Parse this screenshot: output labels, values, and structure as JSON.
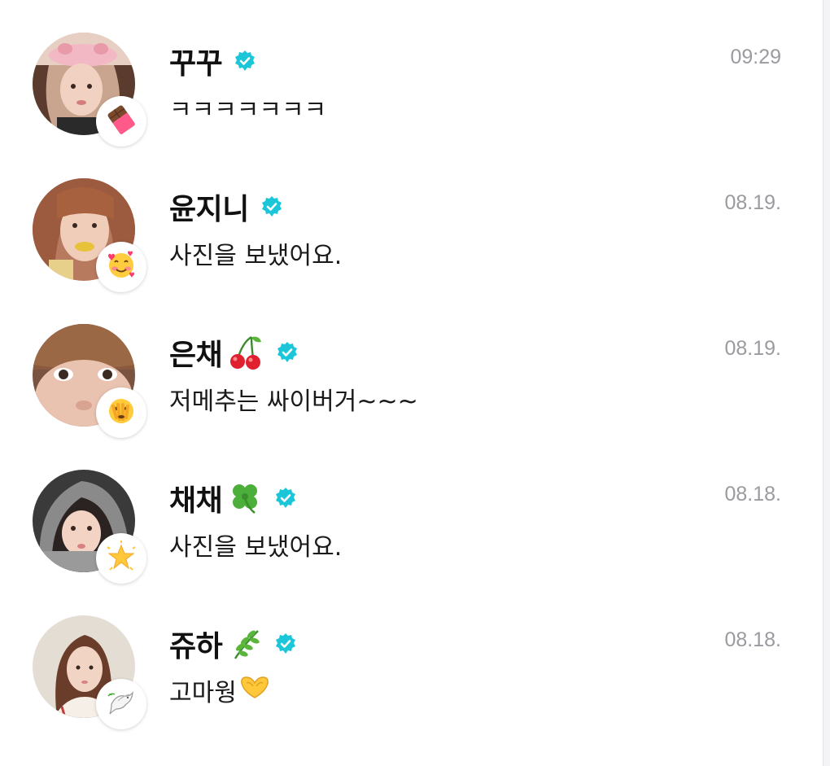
{
  "colors": {
    "verified_badge": "#1cc6d9",
    "time_text": "#9a9aa0",
    "name_text": "#111111"
  },
  "chats": [
    {
      "name": "꾸꾸",
      "name_emoji": "",
      "badge_icon": "chocolate-bar-icon",
      "last_message": "ㅋㅋㅋㅋㅋㅋㅋ",
      "message_emoji": "",
      "time": "09:29"
    },
    {
      "name": "윤지니",
      "name_emoji": "",
      "badge_icon": "smiling-face-with-hearts-icon",
      "last_message": "사진을 보냈어요.",
      "message_emoji": "",
      "time": "08.19."
    },
    {
      "name": "은채",
      "name_emoji": "cherries-icon",
      "badge_icon": "face-with-peeking-eye-icon",
      "last_message": "저메추는 싸이버거~~~",
      "message_emoji": "",
      "time": "08.19."
    },
    {
      "name": "채채",
      "name_emoji": "four-leaf-clover-icon",
      "badge_icon": "glowing-star-icon",
      "last_message": "사진을 보냈어요.",
      "message_emoji": "",
      "time": "08.18."
    },
    {
      "name": "쥬하",
      "name_emoji": "herb-icon",
      "badge_icon": "dove-icon",
      "last_message": "고마웡",
      "message_emoji": "heart-hands-icon",
      "time": "08.18."
    }
  ]
}
